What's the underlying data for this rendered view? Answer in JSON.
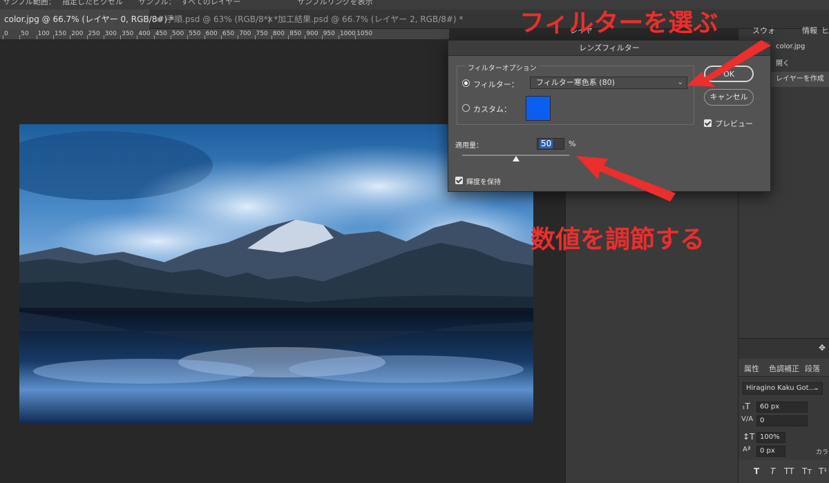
{
  "options_bar": {
    "item1": "サンプル範囲：",
    "item2": "指定したピクセル",
    "item3": "サンプル：",
    "item4": "すべてのレイヤー",
    "item5": "サンプルリングを表示"
  },
  "tabs": [
    {
      "label": "color.jpg @ 66.7% (レイヤー 0, RGB/8#) *",
      "close": "×"
    },
    {
      "label": "手順.psd @ 63% (RGB/8*) *",
      "close": "×"
    },
    {
      "label": "加工結果.psd @ 66.7% (レイヤー 2, RGB/8#) *",
      "close": "×"
    }
  ],
  "ruler": {
    "ticks": [
      "0",
      "50",
      "100",
      "150",
      "200",
      "250",
      "300",
      "350",
      "400",
      "450",
      "500",
      "550",
      "600",
      "650",
      "700",
      "750",
      "800",
      "850",
      "900",
      "950",
      "1000",
      "1050"
    ]
  },
  "dialog": {
    "title": "レンズフィルター",
    "group_label": "フィルターオプション",
    "filter_label": "フィルター：",
    "filter_value": "フィルター寒色系 (80)",
    "custom_label": "カスタム：",
    "custom_color": "#0a5ff0",
    "ok_label": "OK",
    "cancel_label": "キャンセル",
    "preview_label": "プレビュー",
    "amount_label": "適用量：",
    "amount_value": "50",
    "amount_unit": "%",
    "amount_fraction": 0.5,
    "preserve_label": "輝度を保持"
  },
  "right_panel": {
    "tabs": [
      "レイヤ",
      "スウォ",
      "情報",
      "ヒ"
    ],
    "history_file": "color.jpg",
    "history_items": [
      "開く",
      "レイヤーを作成"
    ]
  },
  "properties_panel": {
    "tabs": [
      "属性",
      "色調補正",
      "段落"
    ],
    "font": "Hiragino Kaku Got...",
    "size": "60 px",
    "kerning": "0",
    "scale": "100%",
    "baseline": "0 px",
    "color_label": "カラー",
    "style_buttons": [
      "T",
      "T",
      "TT",
      "Tт",
      "T¹"
    ]
  },
  "annotations": {
    "top": "フィルターを選ぶ",
    "bottom": "数値を調節する"
  },
  "colors": {
    "annotation": "#ec2e2c",
    "selection": "#2f63b8"
  }
}
